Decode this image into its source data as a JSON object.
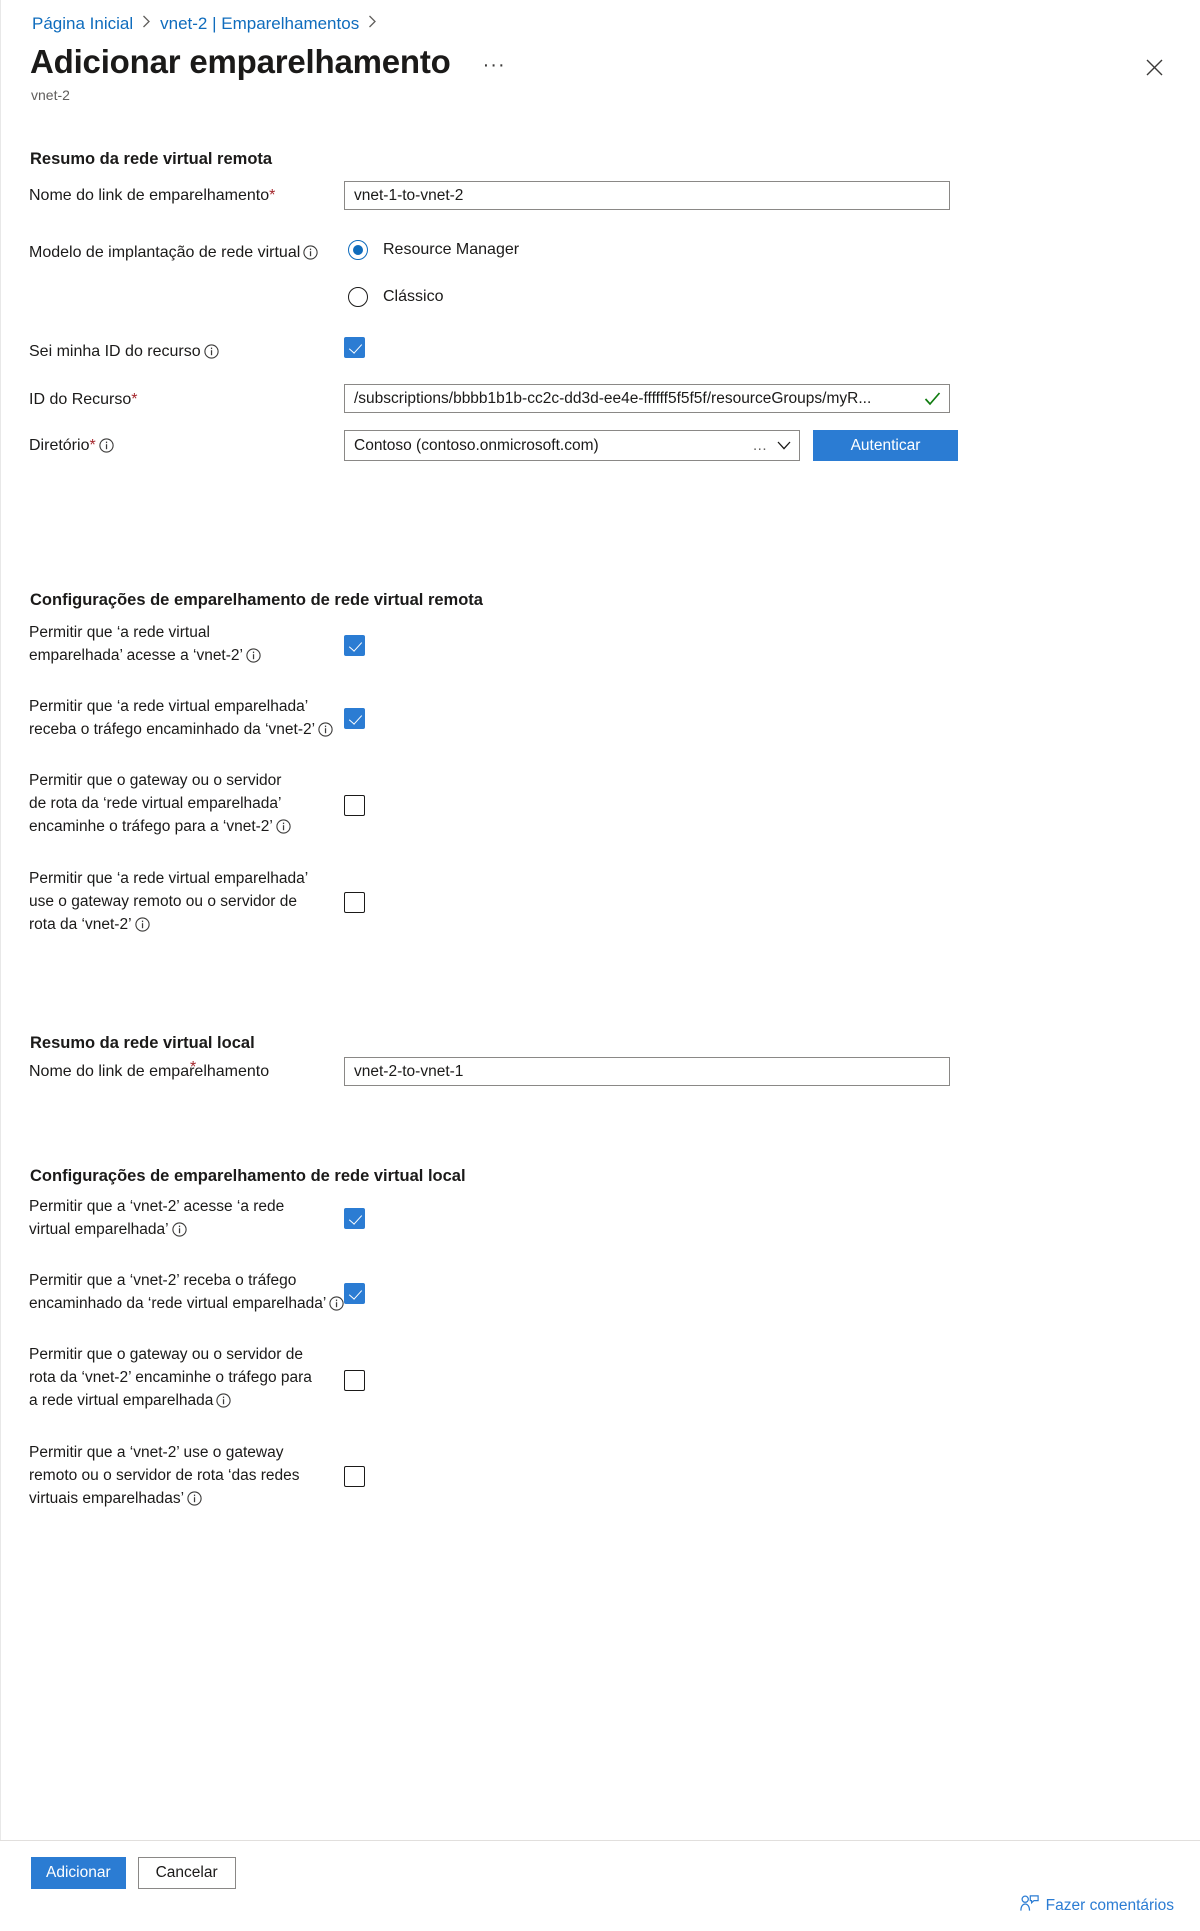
{
  "breadcrumb": {
    "items": [
      {
        "label": "Página Inicial"
      },
      {
        "label": "vnet-2 | Emparelhamentos"
      }
    ],
    "separator": "❯"
  },
  "header": {
    "title": "Adicionar emparelhamento",
    "subtitle": "vnet-2",
    "ellipsis_label": "···",
    "close_label": "Fechar"
  },
  "remote_summary": {
    "section_title": "Resumo da rede virtual remota",
    "peering_link_name": {
      "label": "Nome do link de emparelhamento",
      "required_mark": "*",
      "value": "vnet-1-to-vnet-2",
      "placeholder": ""
    },
    "deployment_model": {
      "label": "Modelo de implantação de rede virtual",
      "options": [
        {
          "label": "Resource Manager",
          "checked": true
        },
        {
          "label": "Clássico",
          "checked": false
        }
      ]
    },
    "know_resource_id": {
      "label": "Sei minha ID do recurso",
      "checked": true
    },
    "resource_id": {
      "label": "ID do Recurso",
      "required_mark": "*",
      "value": "/subscriptions/bbbb1b1b-cc2c-dd3d-ee4e-ffffff5f5f5f/resourceGroups/myR...",
      "valid": true
    },
    "directory": {
      "label": "Diretório",
      "required_mark": "*",
      "value": "Contoso (contoso.onmicrosoft.com)",
      "overflow_dots": "...",
      "authenticate_label": "Autenticar"
    }
  },
  "remote_config": {
    "section_title": "Configurações de emparelhamento de rede virtual remota",
    "options": [
      {
        "lines": [
          "Permitir que ‘a rede virtual",
          "emparelhada’ acesse a ‘vnet-2’"
        ],
        "checked": true
      },
      {
        "lines": [
          "Permitir que ‘a rede virtual emparelhada’",
          "receba o tráfego encaminhado da ‘vnet-2’"
        ],
        "checked": true
      },
      {
        "lines": [
          "Permitir que o gateway ou o servidor",
          "de rota da ‘rede virtual emparelhada’",
          "encaminhe o tráfego para a ‘vnet-2’"
        ],
        "checked": false
      },
      {
        "lines": [
          "Permitir que ‘a rede virtual emparelhada’",
          "use o gateway remoto ou o servidor de",
          "rota da ‘vnet-2’"
        ],
        "checked": false
      }
    ]
  },
  "local_summary": {
    "section_title": "Resumo da rede virtual local",
    "peering_link_name": {
      "label": "Nome do link de emparelhamento",
      "value": "vnet-2-to-vnet-1",
      "placeholder": ""
    }
  },
  "local_config": {
    "section_title": "Configurações de emparelhamento de rede virtual local",
    "options": [
      {
        "lines": [
          "Permitir que a ‘vnet-2’ acesse ‘a rede",
          "virtual emparelhada’"
        ],
        "checked": true
      },
      {
        "lines": [
          "Permitir que a ‘vnet-2’ receba o tráfego",
          "encaminhado da ‘rede virtual emparelhada’"
        ],
        "checked": true
      },
      {
        "lines": [
          "Permitir que o gateway ou o servidor de",
          "rota da ‘vnet-2’ encaminhe o tráfego para",
          "a rede virtual emparelhada"
        ],
        "checked": false
      },
      {
        "lines": [
          "Permitir que a ‘vnet-2’ use o gateway",
          "remoto ou o servidor de rota ‘das redes",
          "virtuais emparelhadas’"
        ],
        "checked": false
      }
    ]
  },
  "footer": {
    "add_label": "Adicionar",
    "cancel_label": "Cancelar",
    "feedback_label": "Fazer comentários"
  },
  "colors": {
    "accent": "#2b7cd3",
    "link": "#0f6cbd",
    "required": "#a4262c",
    "valid_check": "#107c10",
    "text": "#1b1a19",
    "muted": "#605e5c",
    "border": "#8a8886"
  }
}
